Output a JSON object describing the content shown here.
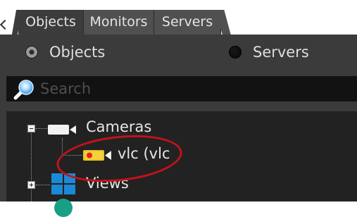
{
  "tabs": [
    {
      "label": "Objects",
      "active": true
    },
    {
      "label": "Monitors",
      "active": false
    },
    {
      "label": "Servers",
      "active": false
    }
  ],
  "radio": {
    "objects_label": "Objects",
    "servers_label": "Servers",
    "selected": "Objects"
  },
  "search": {
    "placeholder": "Search",
    "value": ""
  },
  "tree": {
    "cameras": {
      "label": "Cameras",
      "expanded": true,
      "icon": "camera-icon"
    },
    "vlc": {
      "label": "vlc (vlc",
      "icon": "camera-warning-icon"
    },
    "views": {
      "label": "Views",
      "expanded": false,
      "icon": "views-grid-icon"
    }
  },
  "colors": {
    "panel_bg": "#3b3b3b",
    "tree_bg": "#222222",
    "search_bg": "#121212",
    "accent_blue": "#1b8ad6",
    "annotation_red": "#c4121b"
  }
}
